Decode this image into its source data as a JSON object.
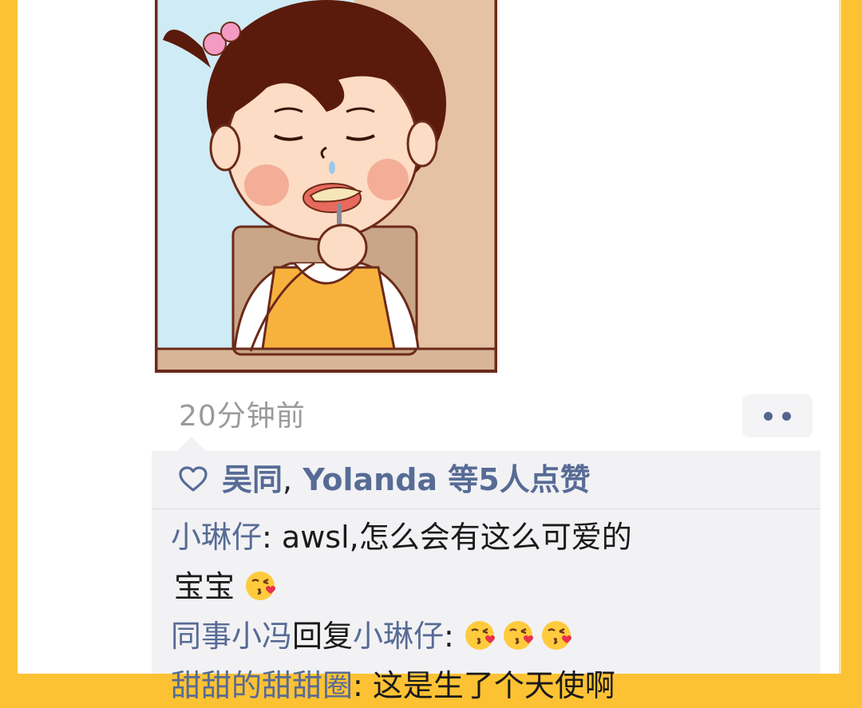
{
  "moment": {
    "time_ago": "20分钟前",
    "more_label": "••"
  },
  "likes": {
    "name1": "吴同",
    "separator": ",",
    "name2": "Yolanda",
    "suffix": "等5人点赞"
  },
  "comments": [
    {
      "author": "小琳仔",
      "sep": ": ",
      "text_line1": "awsl,怎么会有这么可爱的",
      "text_line2": "宝宝",
      "emoji": "kissing-face-heart"
    },
    {
      "author": "同事小冯",
      "reply_word": "回复",
      "reply_to": "小琳仔",
      "sep": ": ",
      "emoji_count": 3,
      "emoji": "kissing-face-heart"
    },
    {
      "author": "甜甜的甜甜圈",
      "sep": ": ",
      "text": "这是生了个天使啊"
    }
  ],
  "colors": {
    "background": "#FDC234",
    "link": "#576B95",
    "panel": "#F2F2F5"
  }
}
